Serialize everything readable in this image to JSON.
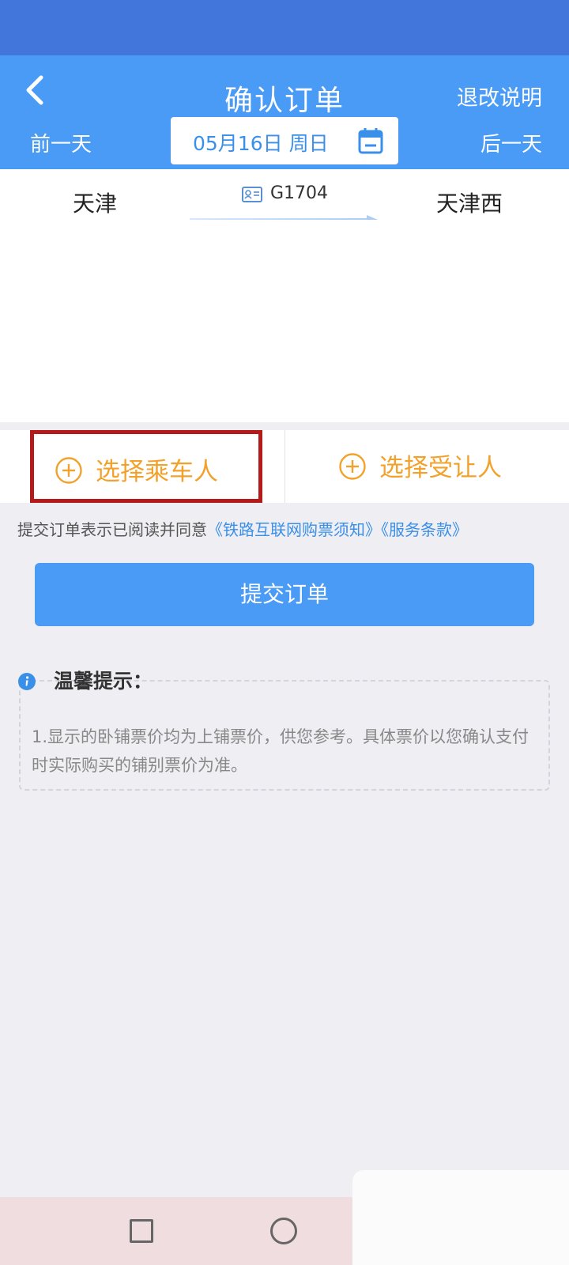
{
  "header": {
    "title": "确认订单",
    "refund_link": "退改说明",
    "prev_day": "前一天",
    "next_day": "后一天",
    "date": "05月16日 周日"
  },
  "trip": {
    "from": "天津",
    "to": "天津西",
    "train_no": "G1704"
  },
  "passenger": {
    "select_passenger": "选择乘车人",
    "select_transferee": "选择受让人"
  },
  "agreement": {
    "prefix": "提交订单表示已阅读并同意",
    "link1": "《铁路互联网购票须知》",
    "link2": "《服务条款》"
  },
  "submit": {
    "label": "提交订单"
  },
  "tips": {
    "title": "温馨提示：",
    "text": "1.显示的卧铺票价均为上铺票价，供您参考。具体票价以您确认支付时实际购买的铺别票价为准。"
  },
  "colors": {
    "header_blue": "#4a9bf6",
    "status_blue": "#4376da",
    "accent_orange": "#f2a12a",
    "highlight_red": "#b41a1a",
    "link_blue": "#3a8fe8"
  },
  "icons": [
    "back-icon",
    "calendar-icon",
    "id-card-icon",
    "plus-circle-icon",
    "info-icon",
    "square-nav-icon",
    "circle-nav-icon"
  ]
}
